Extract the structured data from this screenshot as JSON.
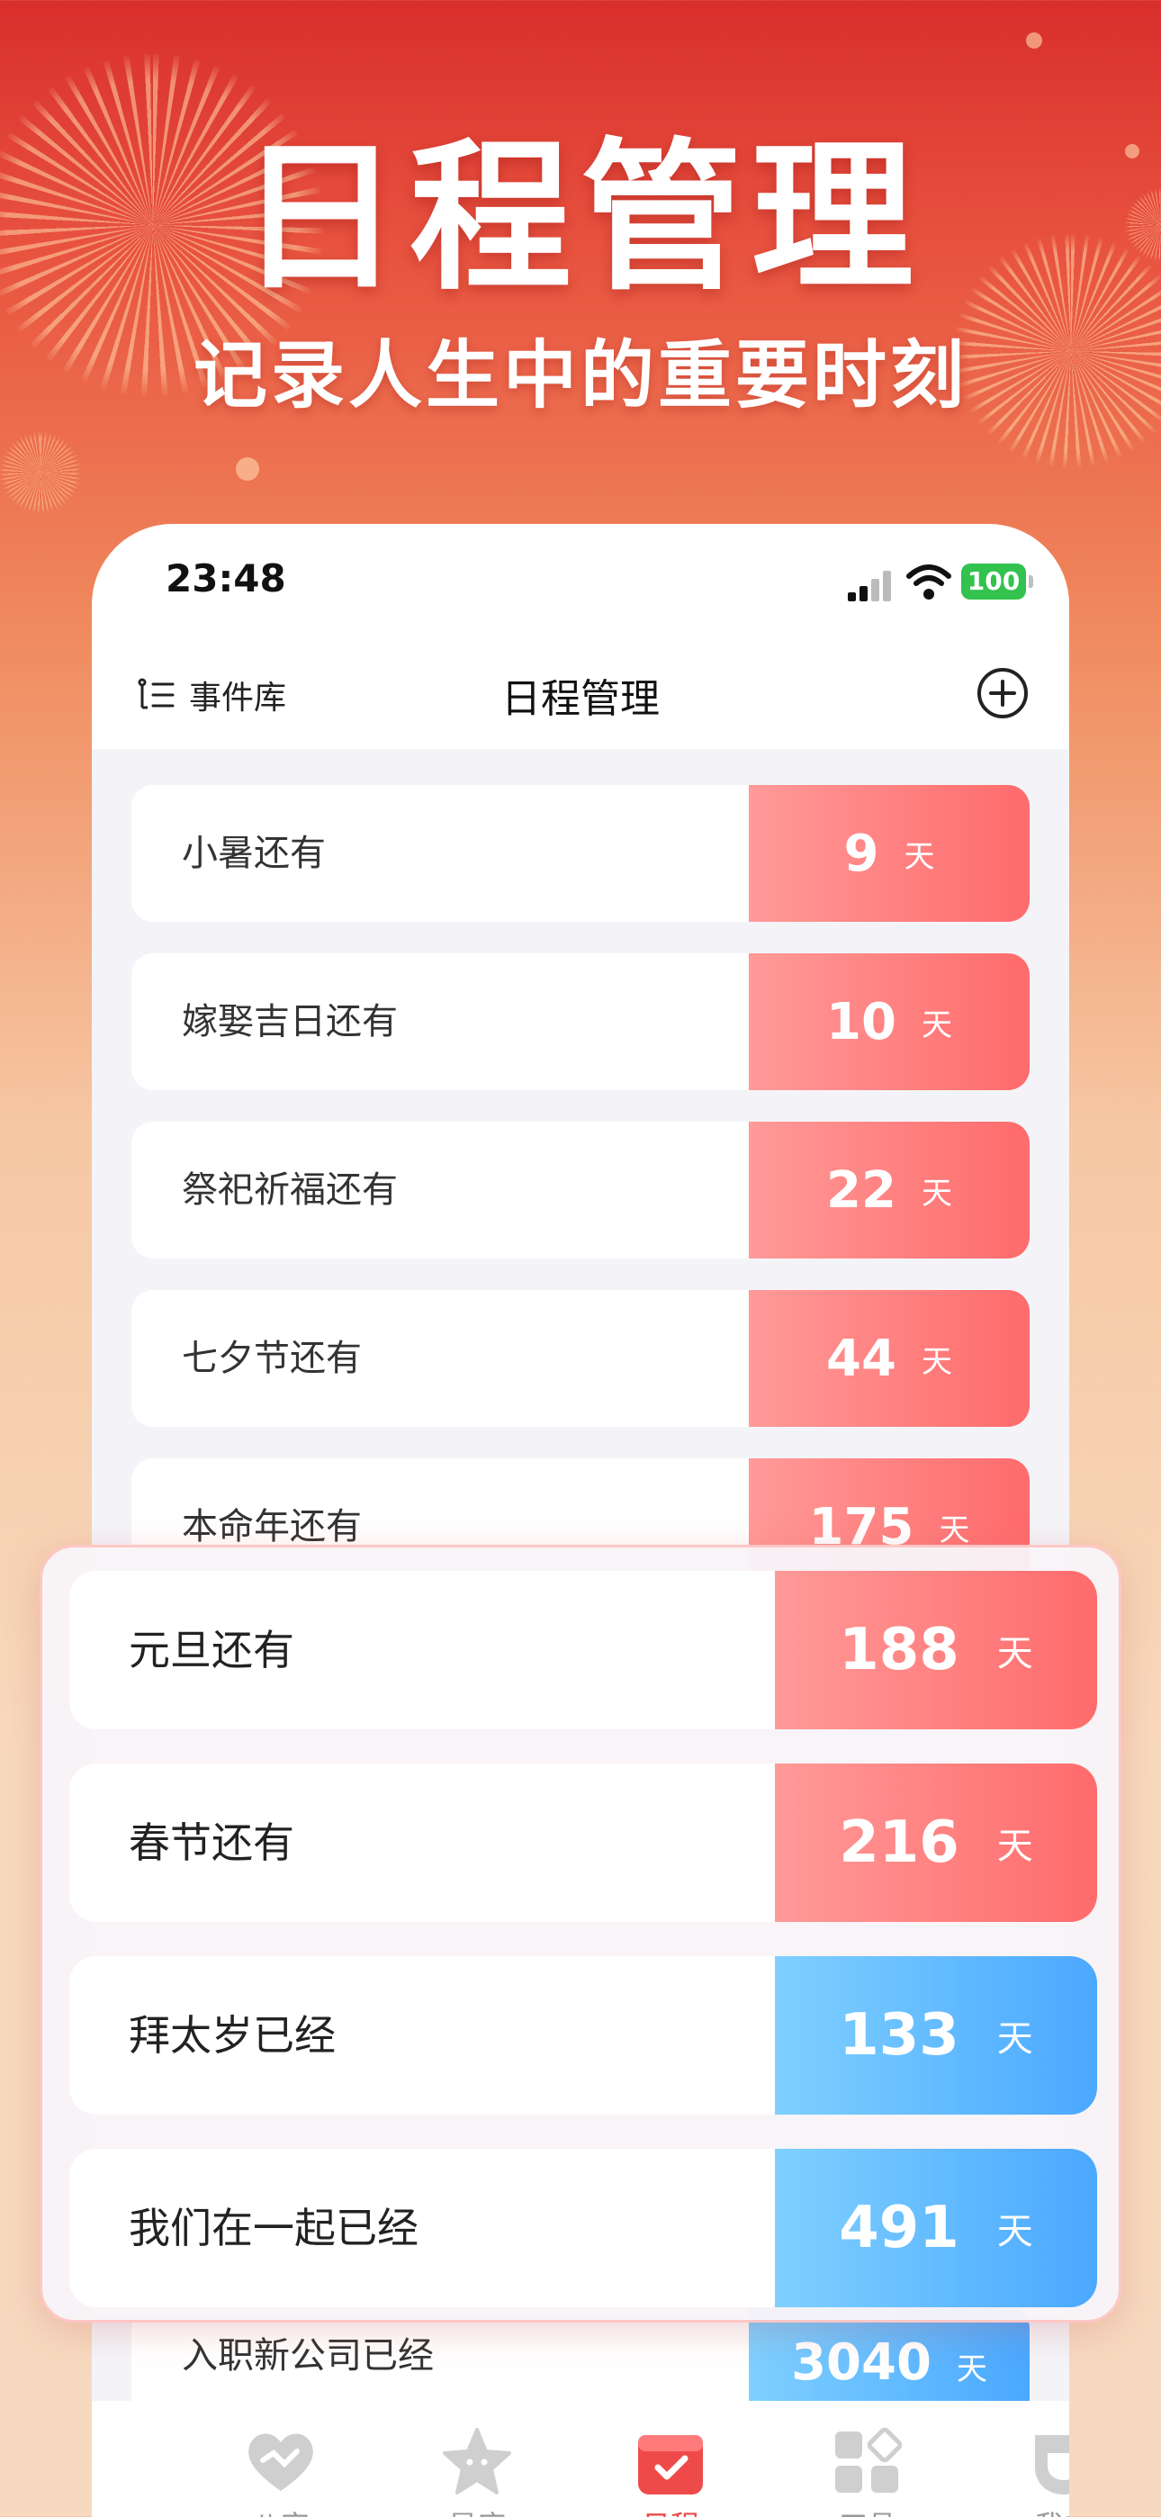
{
  "hero": {
    "title": "日程管理",
    "subtitle": "记录人生中的重要时刻"
  },
  "status_bar": {
    "time": "23:48",
    "battery": "100"
  },
  "nav": {
    "library_label": "事件库",
    "title": "日程管理"
  },
  "events": [
    {
      "label": "小暑还有",
      "days": "9",
      "unit": "天",
      "type": "countdown"
    },
    {
      "label": "嫁娶吉日还有",
      "days": "10",
      "unit": "天",
      "type": "countdown"
    },
    {
      "label": "祭祀祈福还有",
      "days": "22",
      "unit": "天",
      "type": "countdown"
    },
    {
      "label": "七夕节还有",
      "days": "44",
      "unit": "天",
      "type": "countdown"
    },
    {
      "label": "本命年还有",
      "days": "175",
      "unit": "天",
      "type": "countdown"
    }
  ],
  "highlight_events": [
    {
      "label": "元旦还有",
      "days": "188",
      "unit": "天",
      "type": "countdown"
    },
    {
      "label": "春节还有",
      "days": "216",
      "unit": "天",
      "type": "countdown"
    },
    {
      "label": "拜太岁已经",
      "days": "133",
      "unit": "天",
      "type": "elapsed"
    },
    {
      "label": "我们在一起已经",
      "days": "491",
      "unit": "天",
      "type": "elapsed"
    }
  ],
  "bottom_event": {
    "label": "入职新公司已经",
    "days": "3040",
    "unit": "天",
    "type": "elapsed"
  },
  "tabs": [
    {
      "label": "八字",
      "icon": "heart-icon"
    },
    {
      "label": "星座",
      "icon": "star-icon"
    },
    {
      "label": "日程",
      "icon": "calendar-icon"
    },
    {
      "label": "工具",
      "icon": "grid-icon"
    },
    {
      "label": "我的",
      "icon": "profile-icon"
    }
  ],
  "colors": {
    "countdown_start": "#ff9a98",
    "countdown_end": "#ff6b6c",
    "elapsed_start": "#7fd0ff",
    "elapsed_end": "#4aa8ff",
    "active_tab": "#ef4a4a"
  }
}
